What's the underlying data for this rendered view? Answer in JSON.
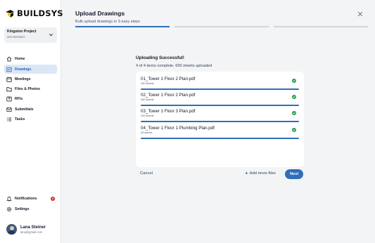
{
  "brand": {
    "name": "BUILDSYS",
    "accent": "#f5c400"
  },
  "project": {
    "name": "Kingston Project",
    "members": "204 Members"
  },
  "nav": [
    {
      "label": "Home",
      "icon": "home-icon"
    },
    {
      "label": "Drawings",
      "icon": "drawings-icon",
      "active": true
    },
    {
      "label": "Meetings",
      "icon": "meetings-icon"
    },
    {
      "label": "Files & Photos",
      "icon": "files-icon"
    },
    {
      "label": "RFIs",
      "icon": "rfi-icon"
    },
    {
      "label": "Submittals",
      "icon": "submittals-icon"
    },
    {
      "label": "Tasks",
      "icon": "tasks-icon"
    }
  ],
  "bottom_nav": {
    "notifications": {
      "label": "Notifications",
      "count": "6",
      "icon": "bell-icon"
    },
    "settings": {
      "label": "Settings",
      "icon": "gear-icon"
    }
  },
  "user": {
    "name": "Lana Steiner",
    "email": "lana@gmail.com"
  },
  "dialog": {
    "title": "Upload Drawings",
    "subtitle": "Bulk upload drawings in 3 easy steps",
    "steps_done": 1,
    "steps_total": 3,
    "status_title": "Uploading Successful!",
    "status_sub": "4 of 4 items complete. 600 sheets uploaded",
    "files": [
      {
        "name": "01_Tower 1 Floor 2 Plan.pdf",
        "sheets": "100 sheets",
        "progress": 1.0
      },
      {
        "name": "02_Tower 1 Floor 2 Plan.pdf",
        "sheets": "340 sheets",
        "progress": 1.0
      },
      {
        "name": "03_Tower 1 Floor 3 Plan.pdf",
        "sheets": "120 sheets",
        "progress": 1.0
      },
      {
        "name": "04_Tower 1 Floor 1 Plumbing Plan.pdf",
        "sheets": "40 sheets",
        "progress": 1.0
      }
    ],
    "cancel_label": "Cancel",
    "add_more_label": "Add more files",
    "next_label": "Next"
  },
  "colors": {
    "primary": "#2f6fb7",
    "success": "#22a34a",
    "badge": "#dc2626"
  }
}
